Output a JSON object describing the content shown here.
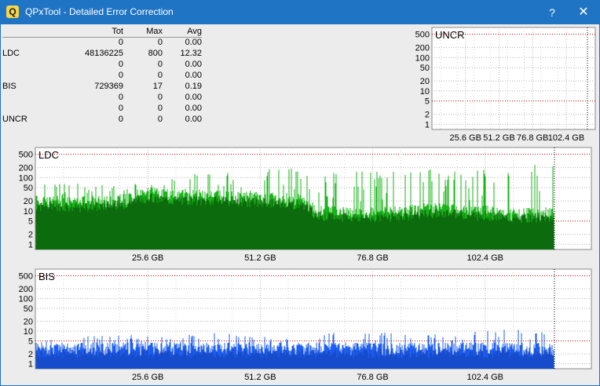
{
  "window": {
    "title": "QPxTool - Detailed Error Correction",
    "app_icon_letter": "Q",
    "help_label": "?",
    "close_label": "✕"
  },
  "stats_table": {
    "headers": [
      "",
      "Tot",
      "Max",
      "Avg"
    ],
    "rows": [
      [
        "",
        "0",
        "0",
        "0.00"
      ],
      [
        "LDC",
        "48136225",
        "800",
        "12.32"
      ],
      [
        "",
        "0",
        "0",
        "0.00"
      ],
      [
        "",
        "0",
        "0",
        "0.00"
      ],
      [
        "BIS",
        "729369",
        "17",
        "0.19"
      ],
      [
        "",
        "0",
        "0",
        "0.00"
      ],
      [
        "",
        "0",
        "0",
        "0.00"
      ],
      [
        "UNCR",
        "0",
        "0",
        "0.00"
      ]
    ]
  },
  "colors": {
    "titlebar": "#1f74c4",
    "ldc_light": "#18b418",
    "ldc_dark": "#0a5a0a",
    "bis_light": "#1e5ff2",
    "bis_dark": "#082a88",
    "threshold_line": "#c00000"
  },
  "chart_data": [
    {
      "type": "area",
      "title": "UNCR",
      "y_scale": "log",
      "y_tick_labels": [
        "500",
        "200",
        "100",
        "50",
        "20",
        "10",
        "5",
        "2",
        "1"
      ],
      "x_tick_labels": [
        "25.6 GB",
        "51.2 GB",
        "76.8 GB",
        "102.4 GB"
      ],
      "series": [
        {
          "values": []
        }
      ]
    },
    {
      "type": "area",
      "title": "LDC",
      "y_scale": "log",
      "y_tick_labels": [
        "500",
        "200",
        "100",
        "50",
        "20",
        "10",
        "5",
        "2",
        "1"
      ],
      "x_tick_labels": [
        "25.6 GB",
        "51.2 GB",
        "76.8 GB",
        "102.4 GB"
      ],
      "x_gb": [
        0,
        10,
        20,
        25.6,
        30,
        40,
        51.2,
        60,
        64,
        70,
        76.8,
        85,
        90,
        102.4,
        110,
        118
      ],
      "series": [
        {
          "values": [
            20,
            18,
            22,
            35,
            30,
            28,
            25,
            22,
            10,
            9,
            9,
            10,
            12,
            10,
            8,
            9
          ]
        },
        {
          "values": [
            60,
            70,
            90,
            150,
            120,
            150,
            180,
            200,
            120,
            150,
            170,
            160,
            200,
            180,
            200,
            300
          ]
        }
      ]
    },
    {
      "type": "area",
      "title": "BIS",
      "y_scale": "log",
      "y_tick_labels": [
        "500",
        "200",
        "100",
        "50",
        "20",
        "10",
        "5",
        "2",
        "1"
      ],
      "x_tick_labels": [
        "25.6 GB",
        "51.2 GB",
        "76.8 GB",
        "102.4 GB"
      ],
      "x_gb": [
        0,
        10,
        20,
        25.6,
        30,
        40,
        51.2,
        60,
        64,
        70,
        76.8,
        85,
        90,
        102.4,
        110,
        118
      ],
      "series": [
        {
          "values": [
            3,
            3,
            3,
            3,
            3,
            3,
            3,
            3,
            3,
            3,
            3,
            3,
            3,
            3,
            3,
            3
          ]
        },
        {
          "values": [
            6,
            7,
            8,
            7,
            8,
            9,
            8,
            9,
            10,
            10,
            10,
            9,
            11,
            10,
            12,
            12
          ]
        }
      ]
    }
  ]
}
